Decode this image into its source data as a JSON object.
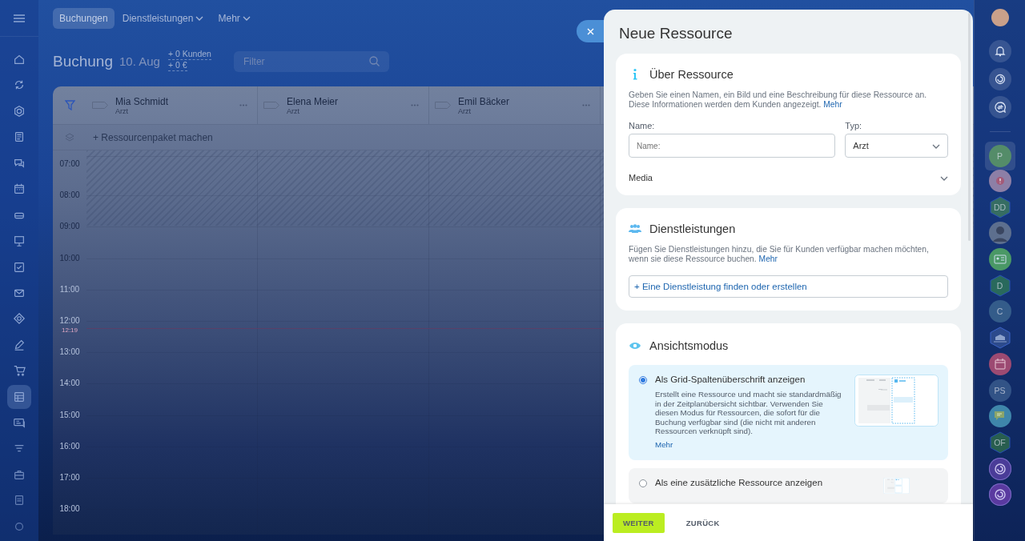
{
  "left_sidebar": {
    "items": [
      {
        "selected": false
      },
      {
        "selected": false
      },
      {
        "selected": false
      },
      {
        "selected": false
      },
      {
        "selected": false
      },
      {
        "selected": false
      },
      {
        "selected": false
      },
      {
        "selected": false
      },
      {
        "selected": false
      },
      {
        "selected": false
      },
      {
        "selected": false
      },
      {
        "selected": false
      },
      {
        "selected": false
      },
      {
        "selected": true
      },
      {
        "selected": false
      },
      {
        "selected": false
      },
      {
        "selected": false
      },
      {
        "selected": false
      },
      {
        "selected": false
      }
    ]
  },
  "top_nav": {
    "tabs": [
      {
        "label": "Buchungen",
        "selected": true,
        "has_menu": false
      },
      {
        "label": "Dienstleistungen",
        "selected": false,
        "has_menu": true
      },
      {
        "label": "Mehr",
        "selected": false,
        "has_menu": true
      }
    ]
  },
  "header": {
    "title": "Buchung",
    "date": "10. Aug",
    "clients": "+ 0 Kunden",
    "revenue": "+ 0 €",
    "filter": {
      "placeholder": "Filter"
    }
  },
  "calendar": {
    "resources": [
      {
        "name": "Mia Schmidt",
        "role": "Arzt"
      },
      {
        "name": "Elena Meier",
        "role": "Arzt"
      },
      {
        "name": "Emil Bäcker",
        "role": "Arzt"
      }
    ],
    "add_package": "+ Ressourcenpaket machen",
    "hours": [
      "07:00",
      "08:00",
      "09:00",
      "10:00",
      "11:00",
      "12:00",
      "13:00",
      "14:00",
      "15:00",
      "16:00",
      "17:00",
      "18:00"
    ],
    "current_time": "12:19"
  },
  "panel": {
    "title": "Neue Ressource",
    "about": {
      "title": "Über Ressource",
      "description": "Geben Sie einen Namen, ein Bild und eine Beschreibung für diese Ressource an. Diese Informationen werden dem Kunden angezeigt.",
      "link": "Mehr",
      "name_label": "Name:",
      "name_placeholder": "Name:",
      "type_label": "Typ:",
      "type_value": "Arzt",
      "media": "Media"
    },
    "services": {
      "title": "Dienstleistungen",
      "description": "Fügen Sie Dienstleistungen hinzu, die Sie für Kunden verfügbar machen möchten, wenn sie diese Ressource buchen.",
      "link": "Mehr",
      "add_button": "+ Eine Dienstleistung finden oder erstellen"
    },
    "view_mode": {
      "title": "Ansichtsmodus",
      "options": [
        {
          "title": "Als Grid-Spaltenüberschrift anzeigen",
          "description": "Erstellt eine Ressource und macht sie standardmäßig in der Zeitplanübersicht sichtbar. Verwenden Sie diesen Modus für Ressourcen, die sofort für die Buchung verfügbar sind (die nicht mit anderen Ressourcen verknüpft sind).",
          "link": "Mehr",
          "selected": true
        },
        {
          "title": "Als eine zusätzliche Ressource anzeigen",
          "selected": false
        }
      ]
    },
    "buttons": {
      "next": "WEITER",
      "back": "ZURÜCK"
    }
  },
  "right_sidebar": {
    "apps": [
      {
        "kind": "circle",
        "label": "P",
        "color": "#5c9a62",
        "selected": true
      },
      {
        "kind": "alert",
        "color": "#8d7fa6",
        "selected": false
      },
      {
        "kind": "hexagon",
        "label": "DD",
        "color": "#3e7a5e",
        "selected": false
      },
      {
        "kind": "person",
        "selected": false
      },
      {
        "kind": "card",
        "color": "#4a9866",
        "selected": false
      },
      {
        "kind": "hexagon",
        "label": "D",
        "color": "#2f7658",
        "selected": false
      },
      {
        "kind": "circle",
        "label": "C",
        "color": "#3c6690",
        "selected": false
      },
      {
        "kind": "building",
        "color": "#2c4a8c",
        "selected": false
      },
      {
        "kind": "calendar",
        "color": "#9c4a72",
        "selected": false
      },
      {
        "kind": "circle",
        "label": "PS",
        "color": "#3a5c8e",
        "selected": false
      },
      {
        "kind": "chat",
        "color": "#3f86aa",
        "selected": false
      },
      {
        "kind": "hexagon",
        "label": "OF",
        "color": "#2e6a4c",
        "selected": false
      },
      {
        "kind": "swirl",
        "color": "#4a3c98",
        "selected": false
      },
      {
        "kind": "swirl",
        "color": "#5a3aa0",
        "selected": false
      }
    ]
  }
}
